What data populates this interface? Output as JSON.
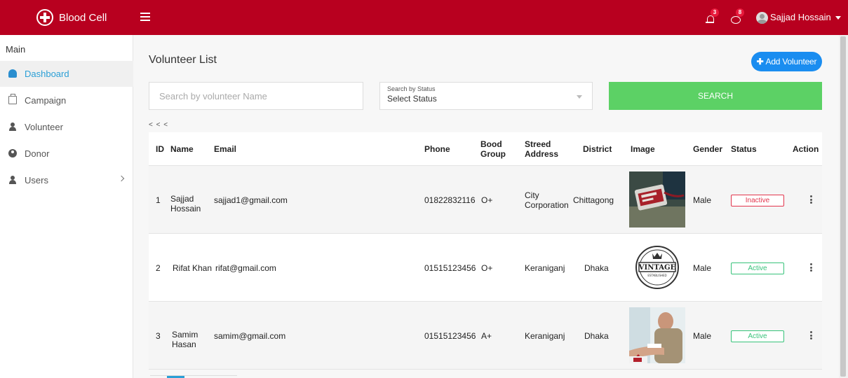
{
  "topbar": {
    "brand": "Blood Cell",
    "notifications_count": "3",
    "messages_count": "8",
    "user_name": "Sajjad Hossain",
    "color": "#b8001f"
  },
  "sidebar": {
    "section": "Main",
    "items": [
      {
        "label": "Dashboard",
        "icon": "dashboard-icon",
        "active": true
      },
      {
        "label": "Campaign",
        "icon": "building-icon"
      },
      {
        "label": "Volunteer",
        "icon": "user-icon"
      },
      {
        "label": "Donor",
        "icon": "donor-icon"
      },
      {
        "label": "Users",
        "icon": "users-icon",
        "has_submenu": true
      }
    ]
  },
  "main": {
    "title": "Volunteer List",
    "add_button": "Add Volunteer",
    "search_placeholder": "Search by volunteer Name",
    "status_label": "Search by Status",
    "status_value": "Select Status",
    "search_button": "SEARCH",
    "pager_top": "< < <",
    "columns": {
      "id": "ID",
      "name": "Name",
      "email": "Email",
      "phone": "Phone",
      "blood_group": "Bood Group",
      "address": "Streed Address",
      "district": "District",
      "image": "Image",
      "gender": "Gender",
      "status": "Status",
      "action": "Action"
    },
    "rows": [
      {
        "id": "1",
        "name": "Sajjad Hossain",
        "email": "sajjad1@gmail.com",
        "phone": "01822832116",
        "blood_group": "O+",
        "address": "City Corporation",
        "district": "Chittagong",
        "gender": "Male",
        "status": "Inactive"
      },
      {
        "id": "2",
        "name": "Rifat Khan",
        "email": "rifat@gmail.com",
        "phone": "01515123456",
        "blood_group": "O+",
        "address": "Keraniganj",
        "district": "Dhaka",
        "gender": "Male",
        "status": "Active"
      },
      {
        "id": "3",
        "name": "Samim Hasan",
        "email": "samim@gmail.com",
        "phone": "01515123456",
        "blood_group": "A+",
        "address": "Keraniganj",
        "district": "Dhaka",
        "gender": "Male",
        "status": "Active"
      }
    ],
    "vintage_logo": {
      "top": "VINTAGE",
      "bottom": "ESTABLISHED"
    },
    "colors": {
      "primary": "#1a8df0",
      "search": "#5cd165",
      "inactive": "#e2354d",
      "active": "#37c37a"
    }
  }
}
